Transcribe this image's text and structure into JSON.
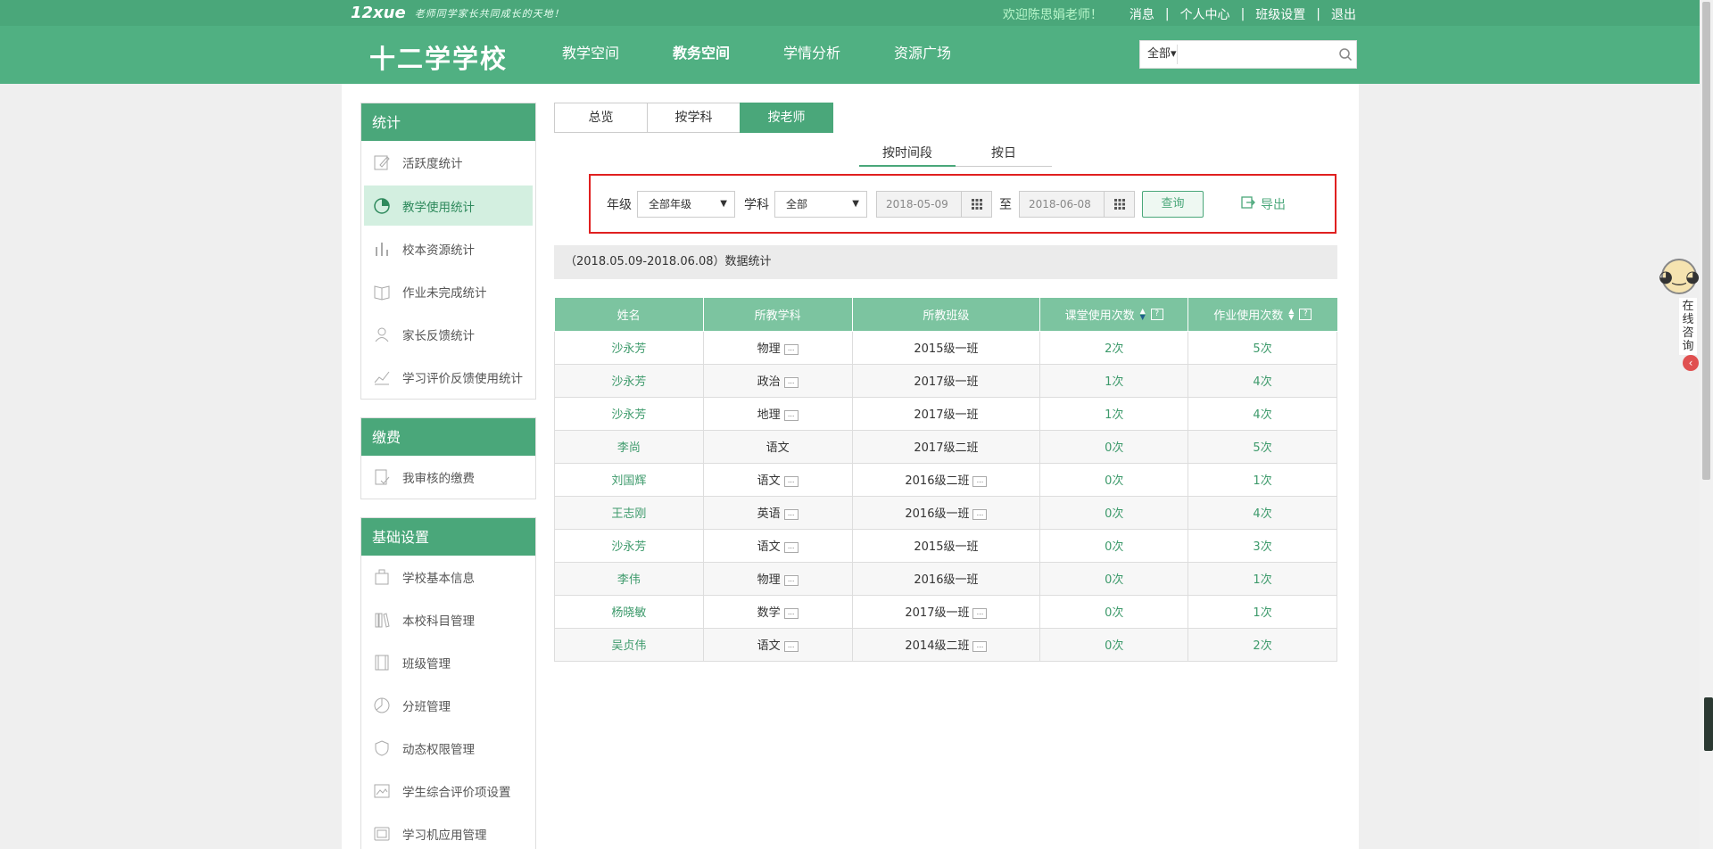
{
  "topbar": {
    "logo": "12xue",
    "slogan": "老师同学家长共同成长的天地！",
    "welcome": "欢迎陈思娟老师！",
    "links": [
      "消息",
      "个人中心",
      "班级设置",
      "退出"
    ]
  },
  "header": {
    "school": "十二学学校",
    "nav": [
      "教学空间",
      "教务空间",
      "学情分析",
      "资源广场"
    ],
    "active_nav": "教务空间",
    "search": {
      "scope": "全部",
      "value": ""
    }
  },
  "sidebar": {
    "sections": [
      {
        "title": "统计",
        "items": [
          "活跃度统计",
          "教学使用统计",
          "校本资源统计",
          "作业未完成统计",
          "家长反馈统计",
          "学习评价反馈使用统计"
        ],
        "active": "教学使用统计"
      },
      {
        "title": "缴费",
        "items": [
          "我审核的缴费"
        ]
      },
      {
        "title": "基础设置",
        "items": [
          "学校基本信息",
          "本校科目管理",
          "班级管理",
          "分班管理",
          "动态权限管理",
          "学生综合评价项设置",
          "学习机应用管理"
        ]
      }
    ]
  },
  "tabs": [
    "总览",
    "按学科",
    "按老师"
  ],
  "active_tab": "按老师",
  "subtabs": [
    "按时间段",
    "按日"
  ],
  "active_subtab": "按时间段",
  "filter": {
    "grade_label": "年级",
    "grade_value": "全部年级",
    "subject_label": "学科",
    "subject_value": "全部",
    "start_date": "2018-05-09",
    "to_label": "至",
    "end_date": "2018-06-08",
    "query_label": "查询",
    "export_label": "导出"
  },
  "range_text": "（2018.05.09-2018.06.08）数据统计",
  "table": {
    "headers": [
      "姓名",
      "所教学科",
      "所教班级",
      "课堂使用次数",
      "作业使用次数"
    ],
    "rows": [
      {
        "name": "沙永芳",
        "subject": "物理",
        "subject_more": true,
        "class": "2015级一班",
        "class_more": false,
        "classroom": "2次",
        "homework": "5次"
      },
      {
        "name": "沙永芳",
        "subject": "政治",
        "subject_more": true,
        "class": "2017级一班",
        "class_more": false,
        "classroom": "1次",
        "homework": "4次"
      },
      {
        "name": "沙永芳",
        "subject": "地理",
        "subject_more": true,
        "class": "2017级一班",
        "class_more": false,
        "classroom": "1次",
        "homework": "4次"
      },
      {
        "name": "李尚",
        "subject": "语文",
        "subject_more": false,
        "class": "2017级二班",
        "class_more": false,
        "classroom": "0次",
        "homework": "5次"
      },
      {
        "name": "刘国辉",
        "subject": "语文",
        "subject_more": true,
        "class": "2016级二班",
        "class_more": true,
        "classroom": "0次",
        "homework": "1次"
      },
      {
        "name": "王志刚",
        "subject": "英语",
        "subject_more": true,
        "class": "2016级一班",
        "class_more": true,
        "classroom": "0次",
        "homework": "4次"
      },
      {
        "name": "沙永芳",
        "subject": "语文",
        "subject_more": true,
        "class": "2015级一班",
        "class_more": false,
        "classroom": "0次",
        "homework": "3次"
      },
      {
        "name": "李伟",
        "subject": "物理",
        "subject_more": true,
        "class": "2016级一班",
        "class_more": false,
        "classroom": "0次",
        "homework": "1次"
      },
      {
        "name": "杨晓敏",
        "subject": "数学",
        "subject_more": true,
        "class": "2017级一班",
        "class_more": true,
        "classroom": "0次",
        "homework": "1次"
      },
      {
        "name": "吴贞伟",
        "subject": "语文",
        "subject_more": true,
        "class": "2014级二班",
        "class_more": true,
        "classroom": "0次",
        "homework": "2次"
      }
    ]
  },
  "consult": {
    "label": "在线咨询"
  },
  "colors": {
    "brand": "#4aa77a",
    "header": "#50b082",
    "highlight": "#e02020"
  }
}
